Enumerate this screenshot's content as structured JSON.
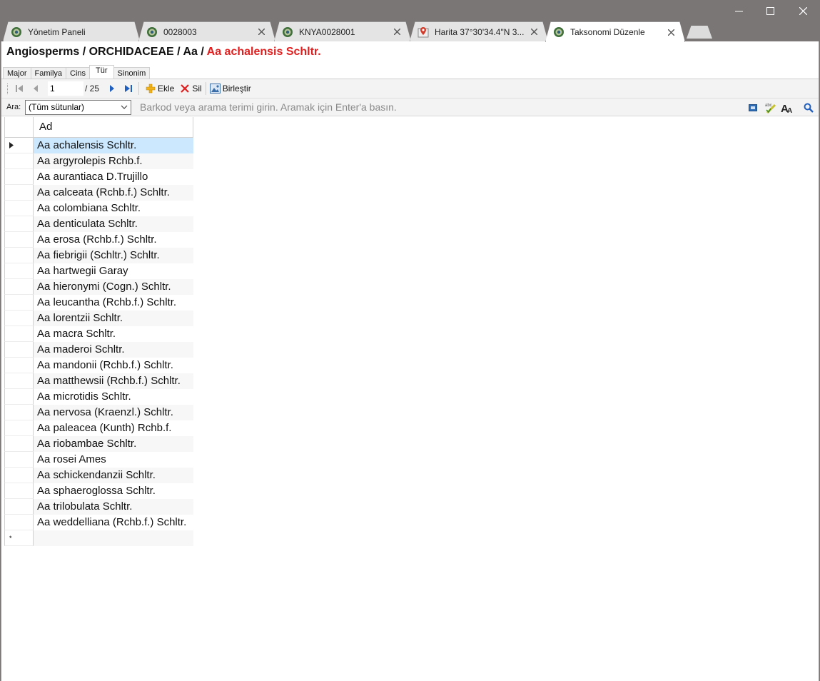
{
  "window": {
    "tabs": [
      {
        "label": "Yönetim Paneli",
        "icon": "globe-icon",
        "closable": false
      },
      {
        "label": "0028003",
        "icon": "globe-icon",
        "closable": true
      },
      {
        "label": "KNYA0028001",
        "icon": "globe-icon",
        "closable": true
      },
      {
        "label": "Harita 37°30'34.4\"N 3...",
        "icon": "map-pin-icon",
        "closable": true
      },
      {
        "label": "Taksonomi Düzenle",
        "icon": "globe-icon",
        "closable": true,
        "active": true
      }
    ]
  },
  "breadcrumb": {
    "path": "Angiosperms / ORCHIDACEAE / Aa / ",
    "current": "Aa achalensis Schltr."
  },
  "subtabs": [
    {
      "label": "Major"
    },
    {
      "label": "Familya"
    },
    {
      "label": "Cins"
    },
    {
      "label": "Tür",
      "active": true
    },
    {
      "label": "Sinonim"
    }
  ],
  "toolbar": {
    "current_page": "1",
    "total": "/ 25",
    "add_label": "Ekle",
    "delete_label": "Sil",
    "merge_label": "Birleştir"
  },
  "search": {
    "label": "Ara:",
    "column_selected": "(Tüm sütunlar)",
    "placeholder": "Barkod veya arama terimi girin. Aramak için Enter'a basın."
  },
  "grid": {
    "column_header": "Ad",
    "rows": [
      "Aa achalensis Schltr.",
      "Aa argyrolepis Rchb.f.",
      "Aa aurantiaca D.Trujillo",
      "Aa calceata (Rchb.f.) Schltr.",
      "Aa colombiana Schltr.",
      "Aa denticulata Schltr.",
      "Aa erosa (Rchb.f.) Schltr.",
      "Aa fiebrigii (Schltr.) Schltr.",
      "Aa hartwegii Garay",
      "Aa hieronymi (Cogn.) Schltr.",
      "Aa leucantha (Rchb.f.) Schltr.",
      "Aa lorentzii Schltr.",
      "Aa macra Schltr.",
      "Aa maderoi Schltr.",
      "Aa mandonii (Rchb.f.) Schltr.",
      "Aa matthewsii (Rchb.f.) Schltr.",
      "Aa microtidis Schltr.",
      "Aa nervosa (Kraenzl.) Schltr.",
      "Aa paleacea (Kunth) Rchb.f.",
      "Aa riobambae Schltr.",
      "Aa rosei Ames",
      "Aa schickendanzii Schltr.",
      "Aa sphaeroglossa Schltr.",
      "Aa trilobulata Schltr.",
      "Aa weddelliana (Rchb.f.) Schltr."
    ],
    "selected_index": 0,
    "new_row_marker": "*"
  },
  "colors": {
    "title_bar": "#7b7676",
    "breadcrumb_current": "#e02020",
    "selected_row": "#cce8ff"
  }
}
